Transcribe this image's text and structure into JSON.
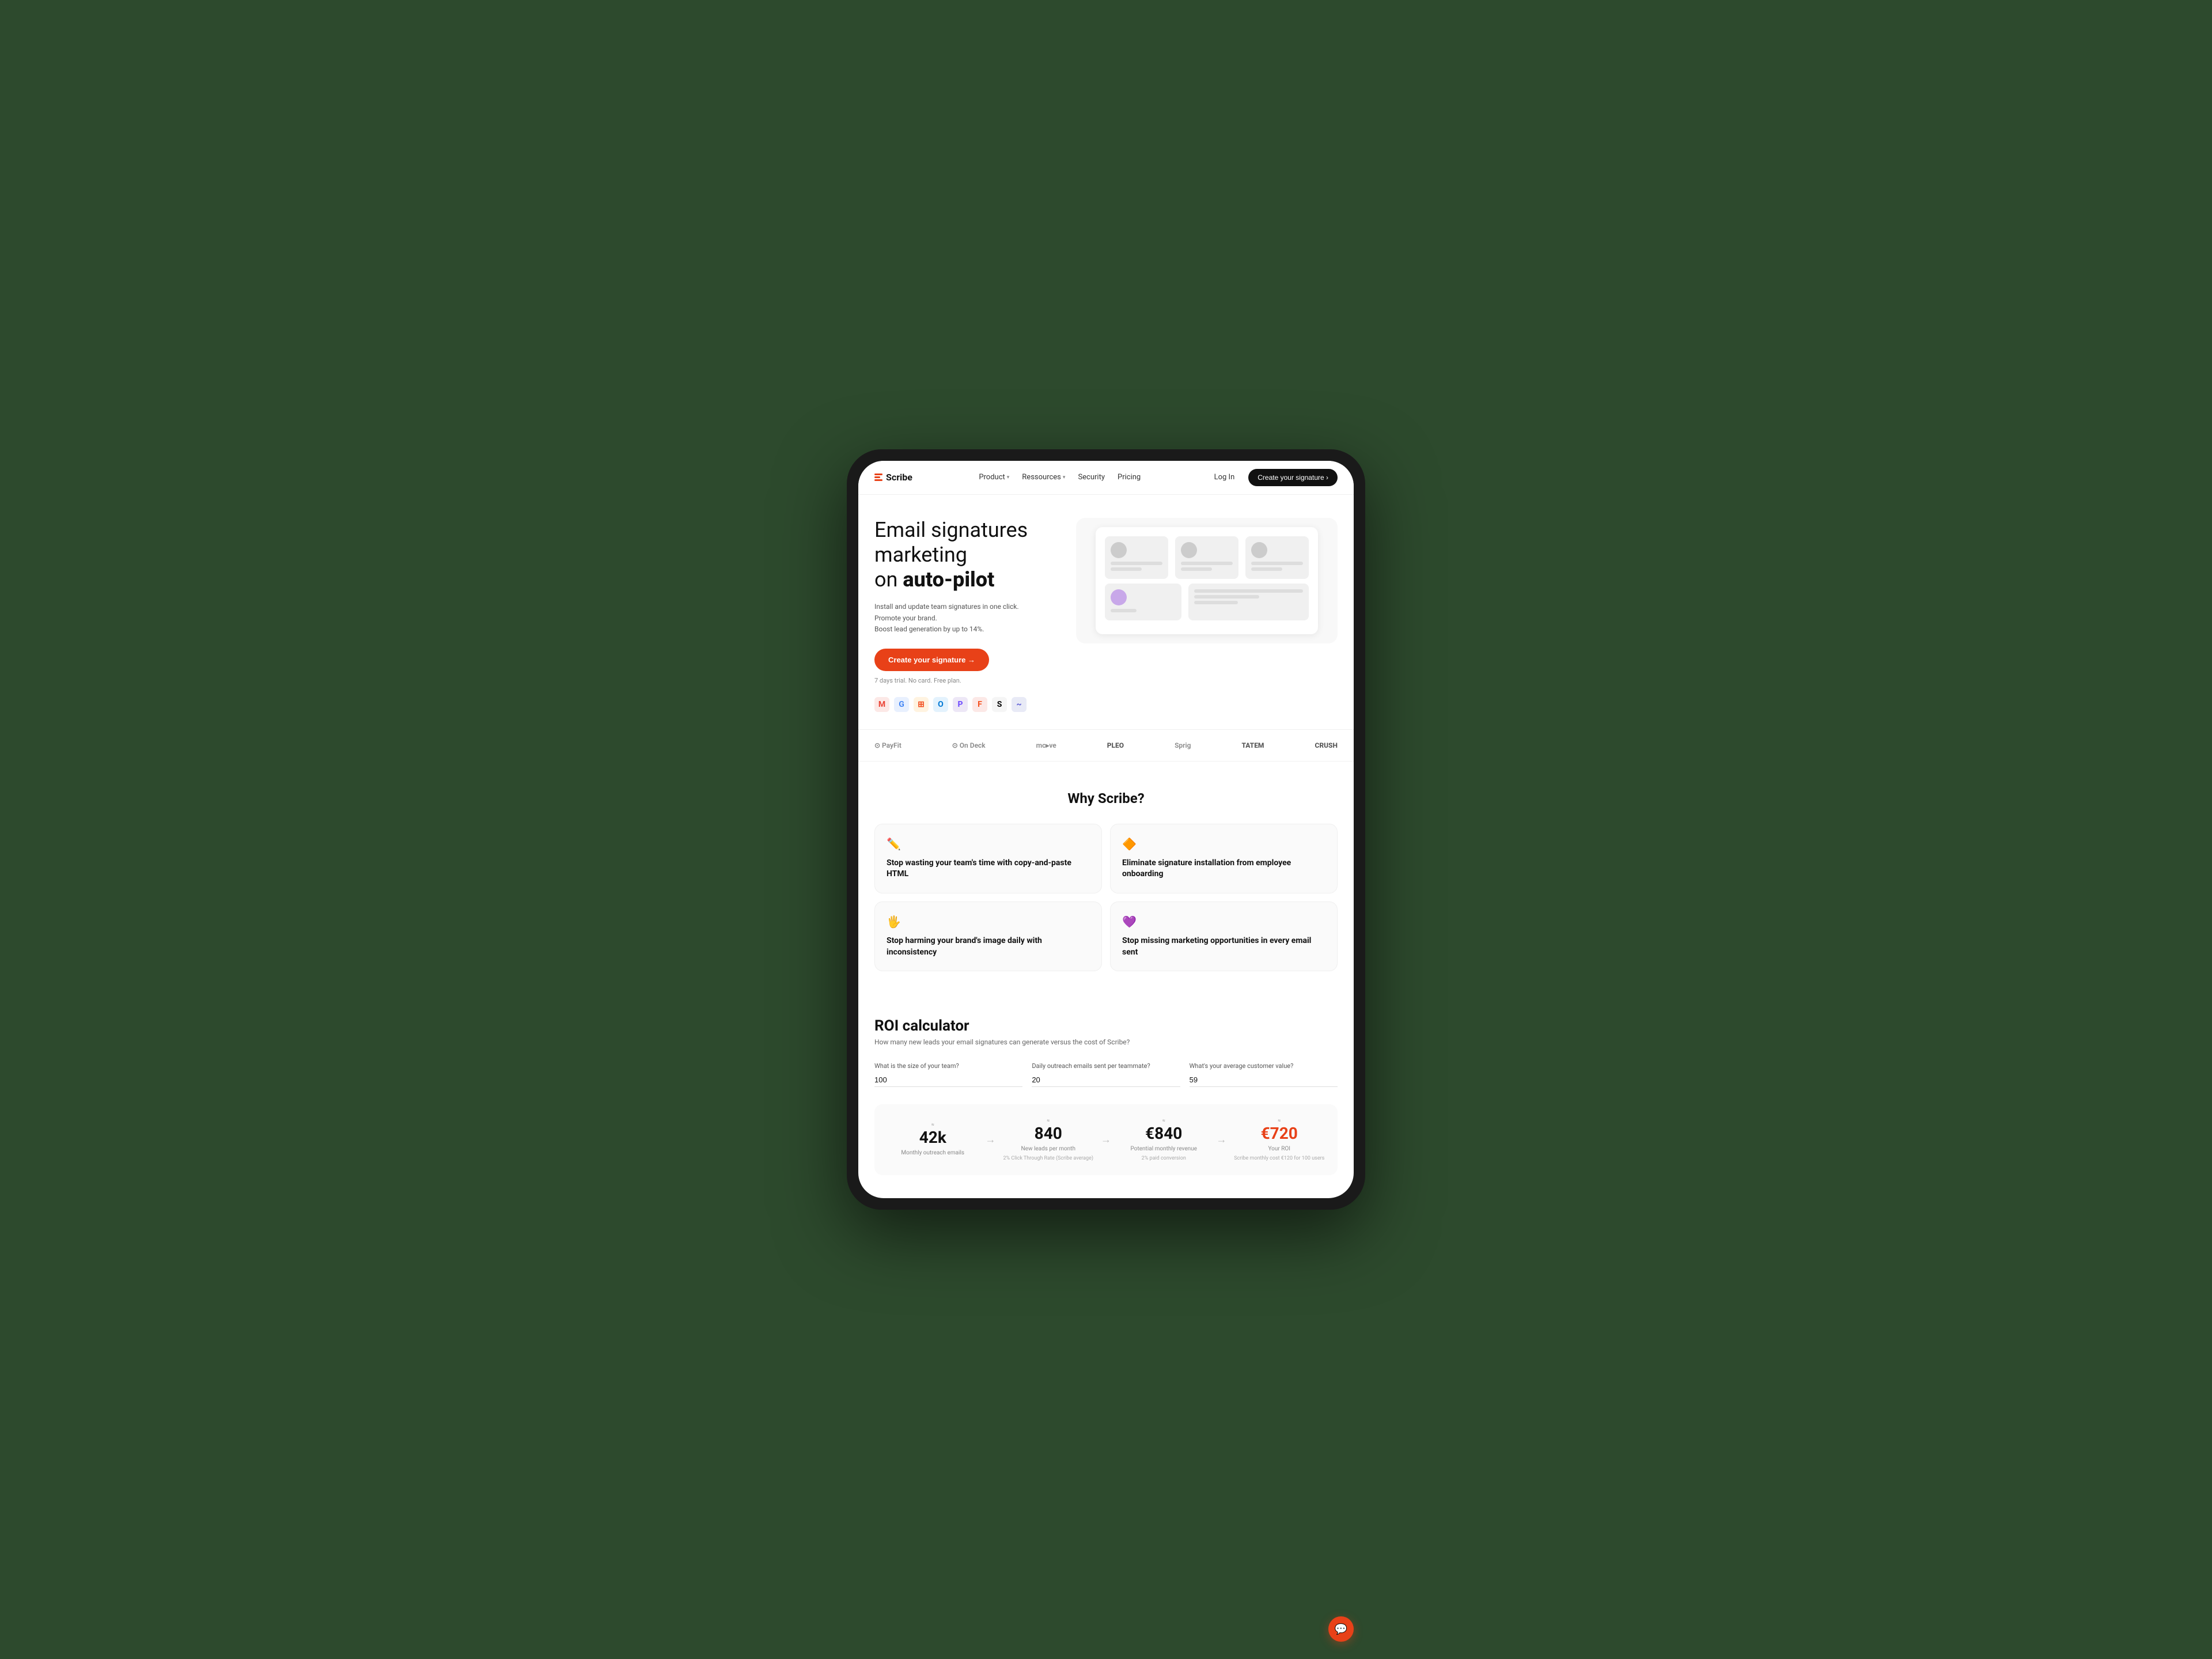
{
  "brand": {
    "name": "Scribe",
    "logo_icon": "≡"
  },
  "navbar": {
    "product_label": "Product",
    "resources_label": "Ressources",
    "security_label": "Security",
    "pricing_label": "Pricing",
    "login_label": "Log In",
    "cta_label": "Create your signature ›"
  },
  "hero": {
    "title_line1": "Email signatures marketing",
    "title_line2": "on ",
    "title_bold": "auto-pilot",
    "subtitle_line1": "Install and update team signatures in one click.",
    "subtitle_line2": "Promote your brand.",
    "subtitle_line3": "Boost lead generation by up to 14%.",
    "cta_label": "Create your signature →",
    "trial_text": "7 days trial. No card. Free plan."
  },
  "logos": [
    {
      "name": "PayFit",
      "style": "normal"
    },
    {
      "name": "On Deck",
      "style": "normal"
    },
    {
      "name": "mcove",
      "style": "normal"
    },
    {
      "name": "PLEO",
      "style": "bold"
    },
    {
      "name": "Sprig",
      "style": "normal"
    },
    {
      "name": "TATEM",
      "style": "bold"
    },
    {
      "name": "CRUSH",
      "style": "bold"
    }
  ],
  "why": {
    "title": "Why Scribe?",
    "cards": [
      {
        "icon": "✏️",
        "title": "Stop wasting your team's time with copy-and-paste HTML"
      },
      {
        "icon": "🔶",
        "title": "Eliminate signature installation from employee onboarding"
      },
      {
        "icon": "🖐️",
        "title": "Stop harming your brand's image daily with inconsistency"
      },
      {
        "icon": "💜",
        "title": "Stop missing marketing opportunities in every email sent"
      }
    ]
  },
  "roi": {
    "title": "ROI calculator",
    "subtitle": "How many new leads your email signatures can generate versus the cost of Scribe?",
    "inputs": [
      {
        "label": "What is the size of your team?",
        "value": "100"
      },
      {
        "label": "Daily outreach emails sent per teammate?",
        "value": "20"
      },
      {
        "label": "What's your average customer value?",
        "value": "59"
      }
    ],
    "results": [
      {
        "number": "42k",
        "label": "Monthly outreach emails",
        "sub": "≈",
        "highlight": false
      },
      {
        "number": "840",
        "label": "New leads per month",
        "sub": "2% Click Through Rate (Scribe average)",
        "highlight": false
      },
      {
        "number": "€840",
        "label": "Potential monthly revenue",
        "sub": "2% paid conversion",
        "highlight": false
      },
      {
        "number": "€720",
        "label": "Your ROI",
        "sub": "Scribe monthly cost €120 for 100 users",
        "highlight": true
      }
    ]
  },
  "chat": {
    "icon": "💬"
  },
  "integration_icons": [
    {
      "name": "gmail",
      "color": "#EA4335",
      "letter": "M"
    },
    {
      "name": "gsuite",
      "color": "#4285F4",
      "letter": "G"
    },
    {
      "name": "microsoft",
      "color": "#F25022",
      "letter": "⊞"
    },
    {
      "name": "outlook",
      "color": "#0078D4",
      "letter": "O"
    },
    {
      "name": "proton",
      "color": "#6D4AFF",
      "letter": "P"
    },
    {
      "name": "front",
      "color": "#F4511E",
      "letter": "F"
    },
    {
      "name": "superhuman",
      "color": "#000",
      "letter": "S"
    },
    {
      "name": "spike",
      "color": "#5B5BD6",
      "letter": "~"
    }
  ]
}
